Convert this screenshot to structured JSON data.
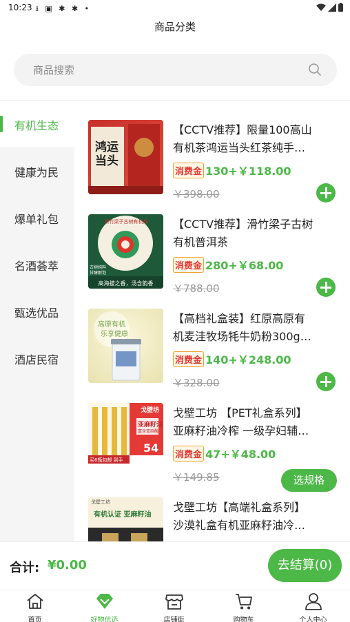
{
  "status": {
    "time": "10:23",
    "left_icons": "⭳ ▣ ✱ ✱ •"
  },
  "header": {
    "title": "商品分类"
  },
  "search": {
    "placeholder": "商品搜索"
  },
  "sidebar": {
    "items": [
      {
        "label": "有机生态",
        "active": true
      },
      {
        "label": "健康为民"
      },
      {
        "label": "爆单礼包"
      },
      {
        "label": "名酒荟萃"
      },
      {
        "label": "甄选优品"
      },
      {
        "label": "酒店民宿"
      }
    ]
  },
  "products": [
    {
      "title1": "【CCTV推荐】限量100高山",
      "title2": "有机茶鸿运当头红茶纯手…",
      "tag": "消费金",
      "price": "130+￥118.00",
      "orig": "￥398.00",
      "action": "add"
    },
    {
      "title1": "【CCTV推荐】滑竹梁子古树",
      "title2": "有机普洱茶",
      "tag": "消费金",
      "price": "280+￥68.00",
      "orig": "￥788.00",
      "action": "add"
    },
    {
      "title1": "【高档礼盒装】红原高原有",
      "title2": "机麦洼牧场牦牛奶粉300g…",
      "tag": "消费金",
      "price": "140+￥248.00",
      "orig": "￥328.00",
      "action": "add"
    },
    {
      "title1": "戈壁工坊 【PET礼盒系列】",
      "title2": "亚麻籽油冷榨 一级孕妇辅…",
      "tag": "消费金",
      "price": "47+￥48.00",
      "orig": "￥149.85",
      "action": "选规格"
    },
    {
      "title1": "戈壁工坊【高端礼盒系列】",
      "title2": "沙漠礼盒有机亚麻籽油冷…"
    }
  ],
  "thumb_text": {
    "p1": "鸿运当头",
    "p2_top": "滑竹梁子古树有机茶",
    "p2_bottom": "高海拔之香，汤含韵香",
    "p2_side": "古树纯料 甘醇耐泡",
    "p3_top": "高原有机",
    "p3_sub": "乐享健康",
    "p4_brand": "戈壁坊",
    "p4_product": "亚麻籽油",
    "p4_sub": "富含亚麻酸",
    "p4_badge": "54",
    "p4_bottom": "买6瓶包邮 到手",
    "p5_brand": "戈壁工坊",
    "p5_banner": "有机认证 亚麻籽油"
  },
  "cart": {
    "total_label": "合计:",
    "total_value": "¥0.00",
    "checkout": "去结算(0)"
  },
  "tabs": [
    {
      "label": "首页",
      "icon": "home-icon"
    },
    {
      "label": "好物优选",
      "icon": "gem-icon",
      "active": true
    },
    {
      "label": "店铺街",
      "icon": "store-icon"
    },
    {
      "label": "购物车",
      "icon": "cart-icon"
    },
    {
      "label": "个人中心",
      "icon": "user-icon"
    }
  ],
  "colors": {
    "accent": "#4cb847",
    "tag_text": "#e53935",
    "tag_border": "#f0a030"
  }
}
